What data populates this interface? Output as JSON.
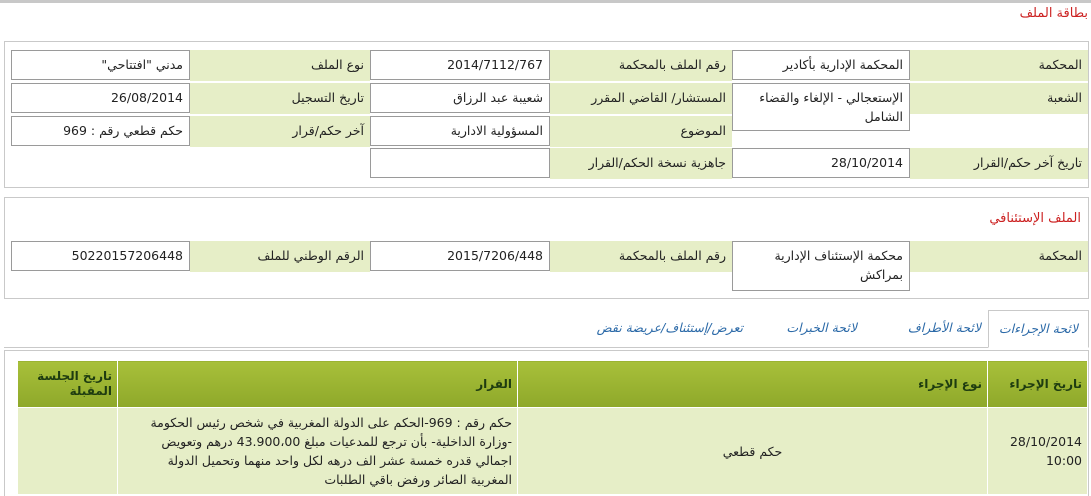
{
  "page_title": "بطاقة الملف",
  "file_card": {
    "court_label": "المحكمة",
    "court_value": "المحكمة الإدارية بأكادير",
    "court_file_no_label": "رقم الملف بالمحكمة",
    "court_file_no_value": "2014/7112/767",
    "file_type_label": "نوع الملف",
    "file_type_value": "مدني \"افتتاحي\"",
    "section_label": "الشعبة",
    "section_value": "الإستعجالي - الإلغاء والقضاء الشامل",
    "judge_label": "المستشار/ القاضي المقرر",
    "judge_value": "شعيبة عبد الرزاق",
    "registration_date_label": "تاريخ التسجيل",
    "registration_date_value": "26/08/2014",
    "subject_label": "الموضوع",
    "subject_value": "المسؤولية الادارية",
    "last_ruling_label": "آخر حكم/قرار",
    "last_ruling_value": "حكم قطعي رقم : 969",
    "last_ruling_date_label": "تاريخ آخر حكم/القرار",
    "last_ruling_date_value": "28/10/2014",
    "copy_ready_label": "جاهزية نسخة الحكم/القرار",
    "copy_ready_value": ""
  },
  "appeal_card": {
    "title": "الملف الإستئنافي",
    "court_label": "المحكمة",
    "court_value": "محكمة الإستئناف الإدارية بمراكش",
    "court_file_no_label": "رقم الملف بالمحكمة",
    "court_file_no_value": "2015/7206/448",
    "national_no_label": "الرقم الوطني للملف",
    "national_no_value": "50220157206448"
  },
  "tabs": [
    {
      "label": "لائحة الإجراءات"
    },
    {
      "label": "لائحة الأطراف"
    },
    {
      "label": "لائحة الخبرات"
    },
    {
      "label": "تعرض/إستئناف/عريضة نقض"
    }
  ],
  "procedures": {
    "headers": {
      "date": "تاريخ الإجراء",
      "type": "نوع الإجراء",
      "decision": "القرار",
      "next_session": "تاريخ الجلسة المقبلة"
    },
    "rows": [
      {
        "date": "28/10/2014 10:00",
        "type": "حكم قطعي",
        "decision": "حكم رقم : 969-الحكم على الدولة المغربية في شخص رئيس الحكومة -وزارة الداخلية- بأن ترجع للمدعيات مبلغ 43.900،00 درهم وتعويض اجمالي قدره خمسة عشر الف درهه لكل واحد منهما وتحميل الدولة المغربية الصائر ورفض باقي الطلبات",
        "next_session": ""
      }
    ]
  }
}
